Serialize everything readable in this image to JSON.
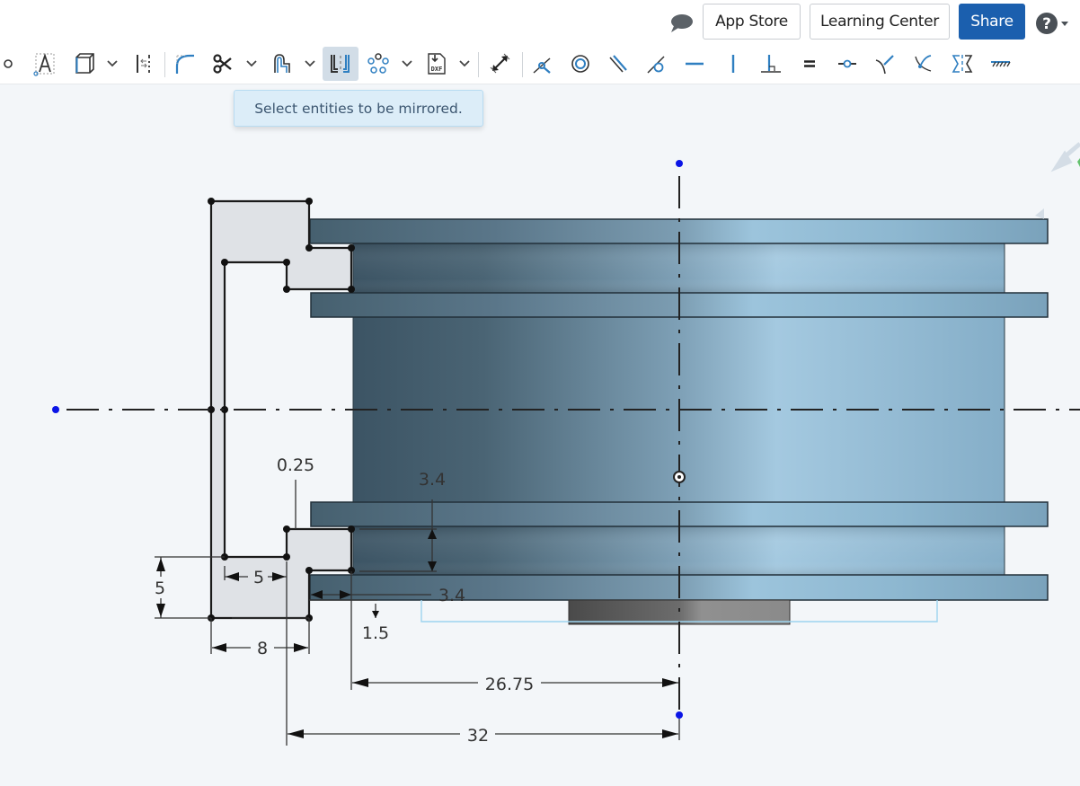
{
  "header": {
    "comment_icon": "comment-icon",
    "app_store_label": "App Store",
    "learning_center_label": "Learning Center",
    "share_label": "Share",
    "help_icon": "help-icon",
    "share_color": "#1b5fae"
  },
  "toolbar": {
    "tools": [
      {
        "name": "point-tool",
        "icon": "point-icon"
      },
      {
        "name": "text-tool",
        "icon": "text-icon"
      },
      {
        "name": "use-tool",
        "icon": "use-icon"
      },
      {
        "name": "construction-tool",
        "icon": "construction-icon"
      },
      {
        "name": "fillet-tool",
        "icon": "fillet-icon"
      },
      {
        "name": "trim-tool",
        "icon": "scissors-icon"
      },
      {
        "name": "offset-tool",
        "icon": "offset-icon"
      },
      {
        "name": "mirror-tool",
        "icon": "mirror-icon",
        "active": true
      },
      {
        "name": "pattern-tool",
        "icon": "circular-pattern-icon"
      },
      {
        "name": "dxf-import-tool",
        "icon": "dxf-icon"
      },
      {
        "name": "dimension-tool",
        "icon": "dimension-icon"
      },
      {
        "name": "coincident-constraint",
        "icon": "coincident-icon"
      },
      {
        "name": "concentric-constraint",
        "icon": "concentric-icon"
      },
      {
        "name": "parallel-constraint",
        "icon": "parallel-icon"
      },
      {
        "name": "tangent-constraint",
        "icon": "tangent-icon"
      },
      {
        "name": "horizontal-constraint",
        "icon": "horizontal-icon"
      },
      {
        "name": "vertical-constraint",
        "icon": "vertical-icon"
      },
      {
        "name": "perpendicular-constraint",
        "icon": "perpendicular-icon"
      },
      {
        "name": "equal-constraint",
        "icon": "equal-icon"
      },
      {
        "name": "midpoint-constraint",
        "icon": "midpoint-icon"
      },
      {
        "name": "normal-constraint",
        "icon": "normal-icon"
      },
      {
        "name": "pierce-constraint",
        "icon": "pierce-icon"
      },
      {
        "name": "symmetric-constraint",
        "icon": "symmetric-icon"
      },
      {
        "name": "fix-constraint",
        "icon": "fix-icon"
      }
    ],
    "accent_color": "#2f7fc1"
  },
  "tooltip": {
    "text": "Select entities to be mirrored."
  },
  "sketch": {
    "dimensions": {
      "d_025": "0.25",
      "d_34_vertical": "3.4",
      "d_34_horizontal": "3.4",
      "d_5_horizontal": "5",
      "d_5_vertical": "5",
      "d_8": "8",
      "d_15": "1.5",
      "d_2675": "26.75",
      "d_32": "32"
    },
    "colors": {
      "part_fill_light": "#a6cbe3",
      "part_fill_dark": "#4d6678",
      "sketch_region": "#dfe2e6",
      "point_blue": "#0a14e6",
      "selection_outline": "#9dd4f0"
    }
  }
}
